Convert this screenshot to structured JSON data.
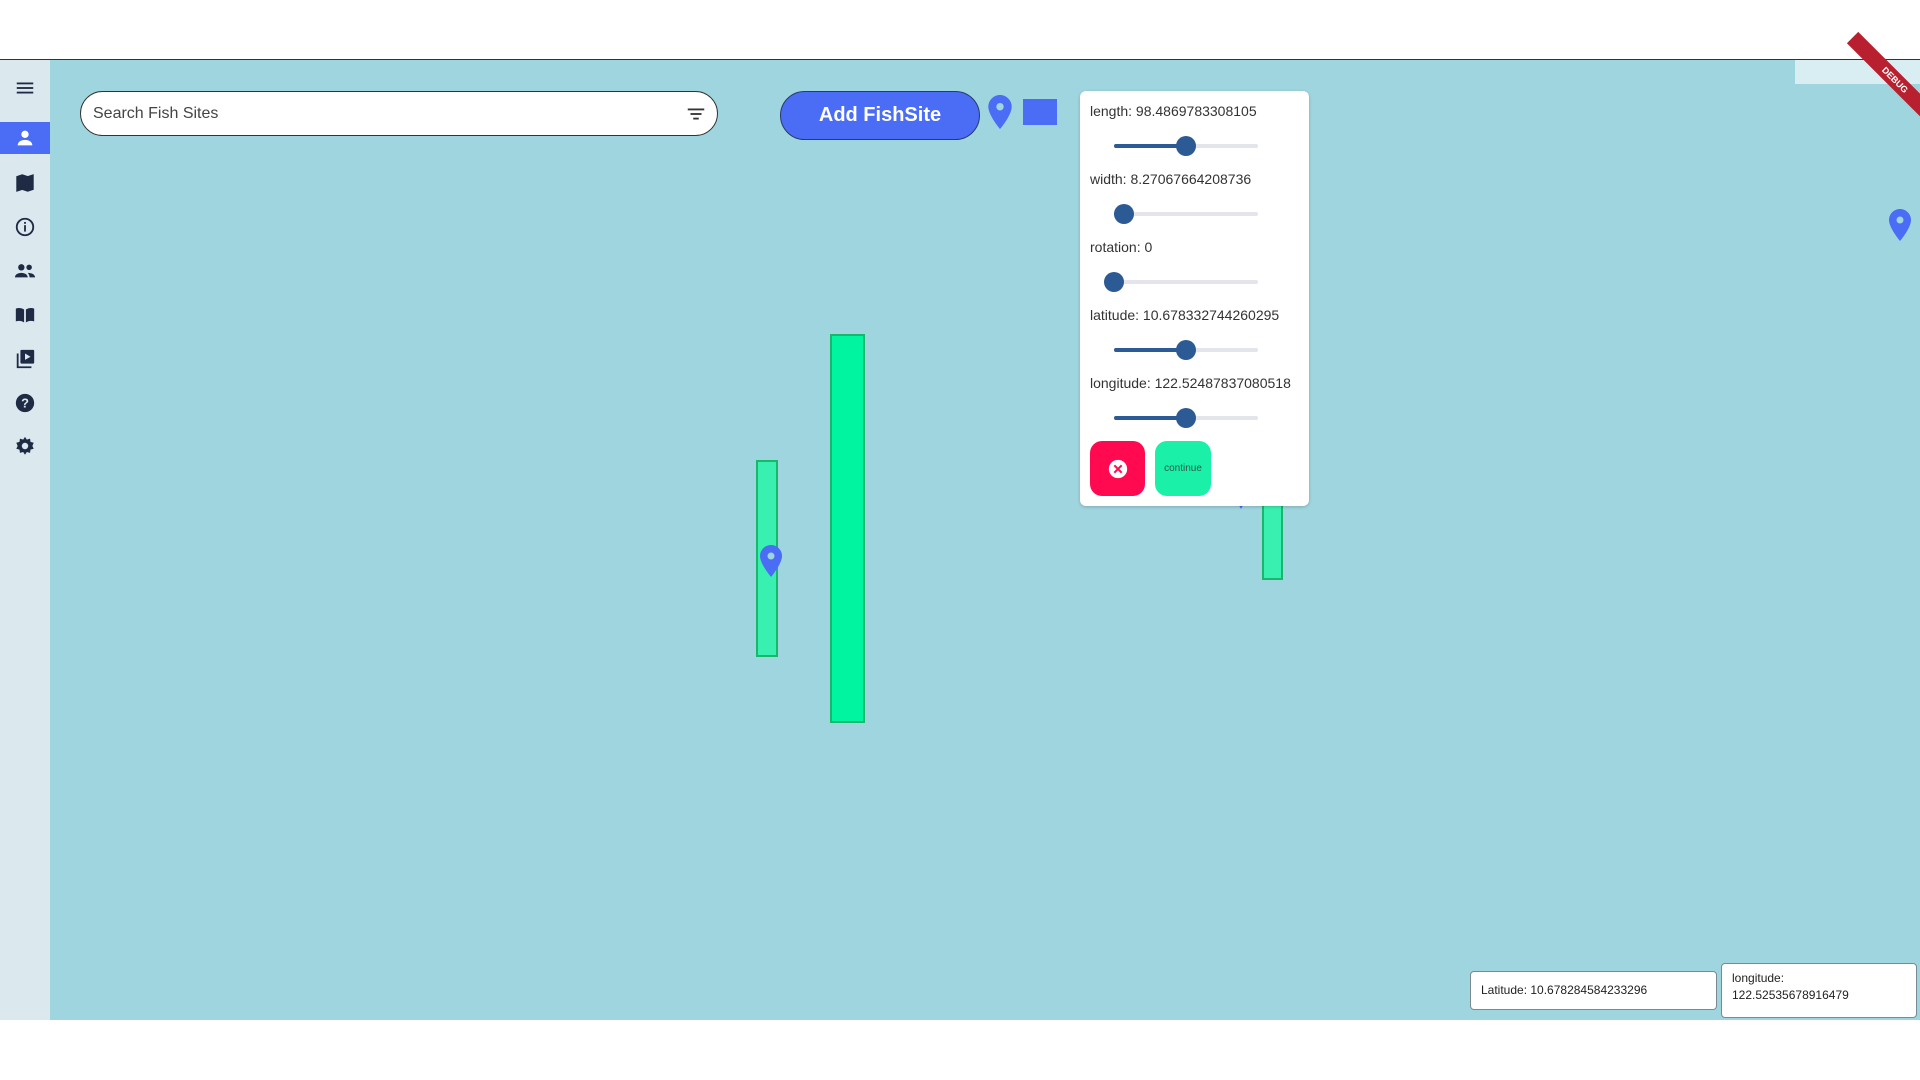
{
  "sidebar": {
    "items": [
      {
        "icon": "menu-icon"
      },
      {
        "icon": "person-icon",
        "active": true
      },
      {
        "icon": "map-icon"
      },
      {
        "icon": "info-icon"
      },
      {
        "icon": "people-icon"
      },
      {
        "icon": "book-icon"
      },
      {
        "icon": "video-library-icon"
      },
      {
        "icon": "help-icon"
      },
      {
        "icon": "settings-icon"
      }
    ]
  },
  "search": {
    "placeholder": "Search Fish Sites",
    "value": ""
  },
  "toolbar": {
    "add_label": "Add FishSite",
    "marker_tool_icon": "map-pin-icon",
    "rect_tool_icon": "rectangle-icon"
  },
  "panel": {
    "length_label": "length: 98.4869783308105",
    "width_label": "width: 8.27067664208736",
    "rotation_label": "rotation: 0",
    "latitude_label": "latitude: 10.678332744260295",
    "longitude_label": "longitude: 122.52487837080518",
    "length_level": 0.5,
    "width_level": 0.07,
    "rotation_level": 0.0,
    "latitude_level": 0.5,
    "longitude_level": 0.5,
    "cancel_icon": "close-circle-icon",
    "continue_label": "continue"
  },
  "status": {
    "latitude": "Latitude: 10.678284584233296",
    "longitude_label": "longitude:",
    "longitude_value": "122.52535678916479"
  },
  "debug_label": "DEBUG",
  "colors": {
    "map_bg": "#9fd5df",
    "accent": "#4b6cf4",
    "site_fill": "#00f5a0",
    "slider": "#2c5a94",
    "cancel": "#ff0a50",
    "continue": "#1af0a8"
  }
}
